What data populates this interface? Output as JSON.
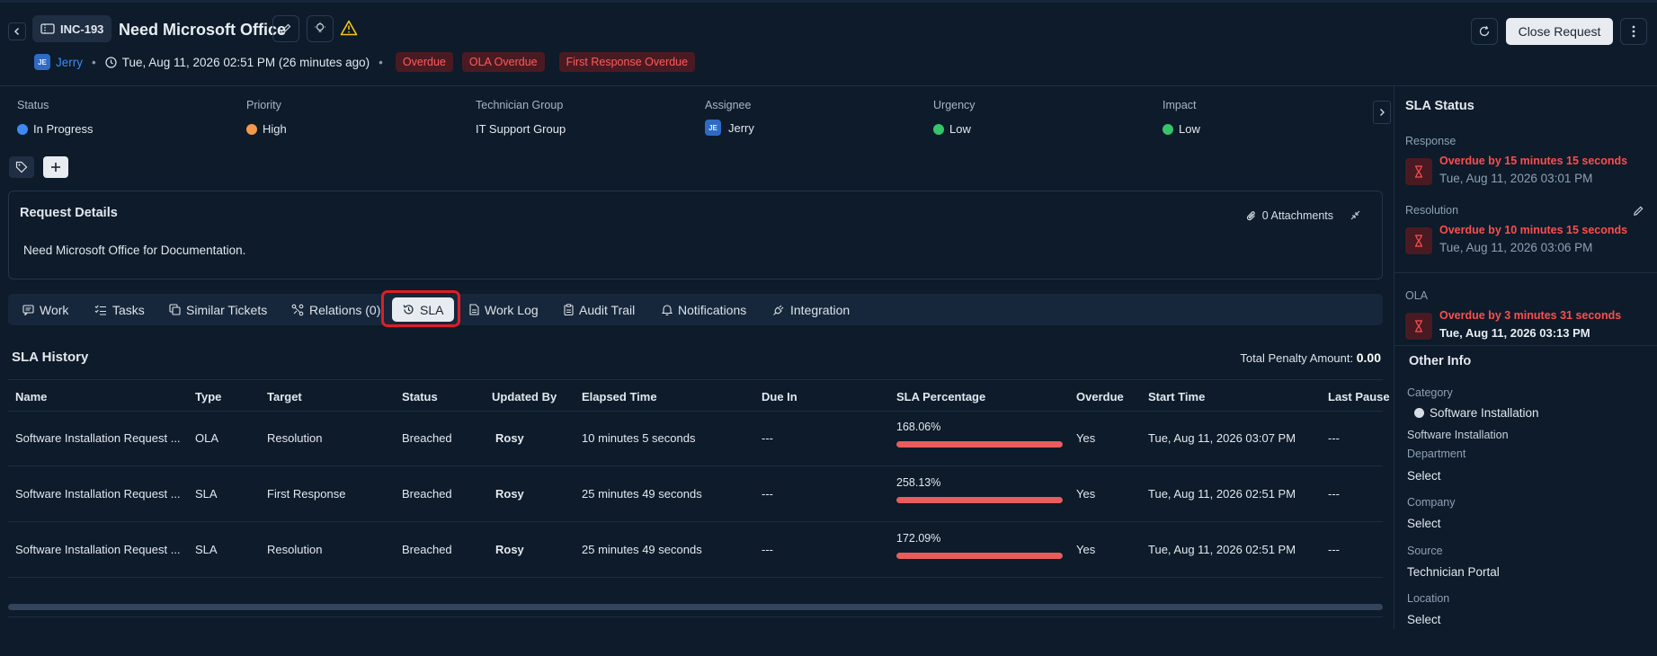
{
  "header": {
    "ticket_id": "INC-193",
    "title": "Need Microsoft Office",
    "requester": "Jerry",
    "requester_initials": "JE",
    "created": "Tue, Aug 11, 2026 02:51 PM (26 minutes ago)",
    "tags": [
      "Overdue",
      "OLA Overdue",
      "First Response Overdue"
    ],
    "close_label": "Close Request"
  },
  "props": {
    "status": {
      "label": "Status",
      "value": "In Progress",
      "color": "#3d8bf0"
    },
    "priority": {
      "label": "Priority",
      "value": "High",
      "color": "#f39a4a"
    },
    "group": {
      "label": "Technician Group",
      "value": "IT Support Group"
    },
    "assignee": {
      "label": "Assignee",
      "value": "Jerry",
      "initials": "JE"
    },
    "urgency": {
      "label": "Urgency",
      "value": "Low",
      "color": "#36c46a"
    },
    "impact": {
      "label": "Impact",
      "value": "Low",
      "color": "#36c46a"
    }
  },
  "details": {
    "title": "Request Details",
    "attachments": "0 Attachments",
    "description": "Need Microsoft Office for Documentation."
  },
  "tabs": [
    "Work",
    "Tasks",
    "Similar Tickets",
    "Relations (0)",
    "SLA",
    "Work Log",
    "Audit Trail",
    "Notifications",
    "Integration"
  ],
  "history": {
    "title": "SLA History",
    "penalty_label": "Total Penalty Amount:",
    "penalty_value": "0.00",
    "columns": [
      "Name",
      "Type",
      "Target",
      "Status",
      "Updated By",
      "Elapsed Time",
      "Due In",
      "SLA Percentage",
      "Overdue",
      "Start Time",
      "Last Pause"
    ],
    "rows": [
      {
        "name": "Software Installation Request ...",
        "type": "OLA",
        "target": "Resolution",
        "status": "Breached",
        "updated_by": "Rosy",
        "elapsed": "10 minutes 5 seconds",
        "due_in": "---",
        "pct": "168.06%",
        "overdue": "Yes",
        "start": "Tue, Aug 11, 2026 03:07 PM",
        "last_pause": "---"
      },
      {
        "name": "Software Installation Request ...",
        "type": "SLA",
        "target": "First Response",
        "status": "Breached",
        "updated_by": "Rosy",
        "elapsed": "25 minutes 49 seconds",
        "due_in": "---",
        "pct": "258.13%",
        "overdue": "Yes",
        "start": "Tue, Aug 11, 2026 02:51 PM",
        "last_pause": "---"
      },
      {
        "name": "Software Installation Request ...",
        "type": "SLA",
        "target": "Resolution",
        "status": "Breached",
        "updated_by": "Rosy",
        "elapsed": "25 minutes 49 seconds",
        "due_in": "---",
        "pct": "172.09%",
        "overdue": "Yes",
        "start": "Tue, Aug 11, 2026 02:51 PM",
        "last_pause": "---"
      }
    ]
  },
  "sla_status": {
    "title": "SLA Status",
    "response": {
      "label": "Response",
      "overdue": "Overdue by 15 minutes 15 seconds",
      "time": "Tue, Aug 11, 2026 03:01 PM"
    },
    "resolution": {
      "label": "Resolution",
      "overdue": "Overdue by 10 minutes 15 seconds",
      "time": "Tue, Aug 11, 2026 03:06 PM"
    },
    "ola": {
      "label": "OLA",
      "overdue": "Overdue by 3 minutes 31 seconds",
      "time": "Tue, Aug 11, 2026 03:13 PM"
    }
  },
  "other_info": {
    "title": "Other Info",
    "category_label": "Category",
    "category_value": "Software Installation",
    "category_sub": "Software Installation",
    "department_label": "Department",
    "department_value": "Select",
    "company_label": "Company",
    "company_value": "Select",
    "source_label": "Source",
    "source_value": "Technician Portal",
    "location_label": "Location",
    "location_value": "Select"
  }
}
